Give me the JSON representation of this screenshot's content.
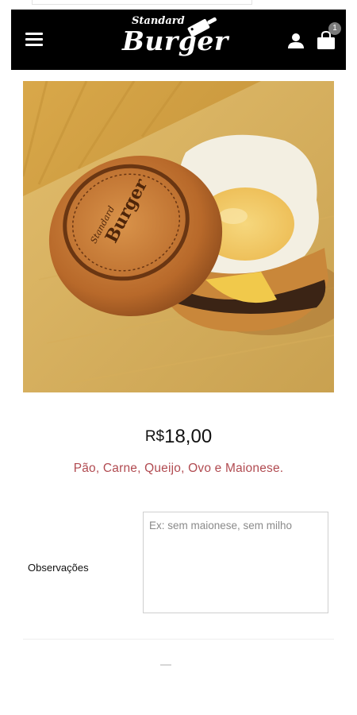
{
  "header": {
    "logo_small": "Standard",
    "logo_big": "Burger",
    "cart_count": "1",
    "icons": {
      "menu": "hamburger-menu-icon",
      "user": "user-icon",
      "cart": "shopping-bag-icon"
    }
  },
  "product": {
    "image": "burger-photo",
    "price_currency": "R$",
    "price_value": "18,00",
    "description": "Pão, Carne, Queijo, Ovo e Maionese."
  },
  "form": {
    "observations_label": "Observações",
    "observations_placeholder": "Ex: sem maionese, sem milho",
    "observations_value": ""
  },
  "colors": {
    "header_bg": "#000000",
    "description": "#b14b51"
  }
}
